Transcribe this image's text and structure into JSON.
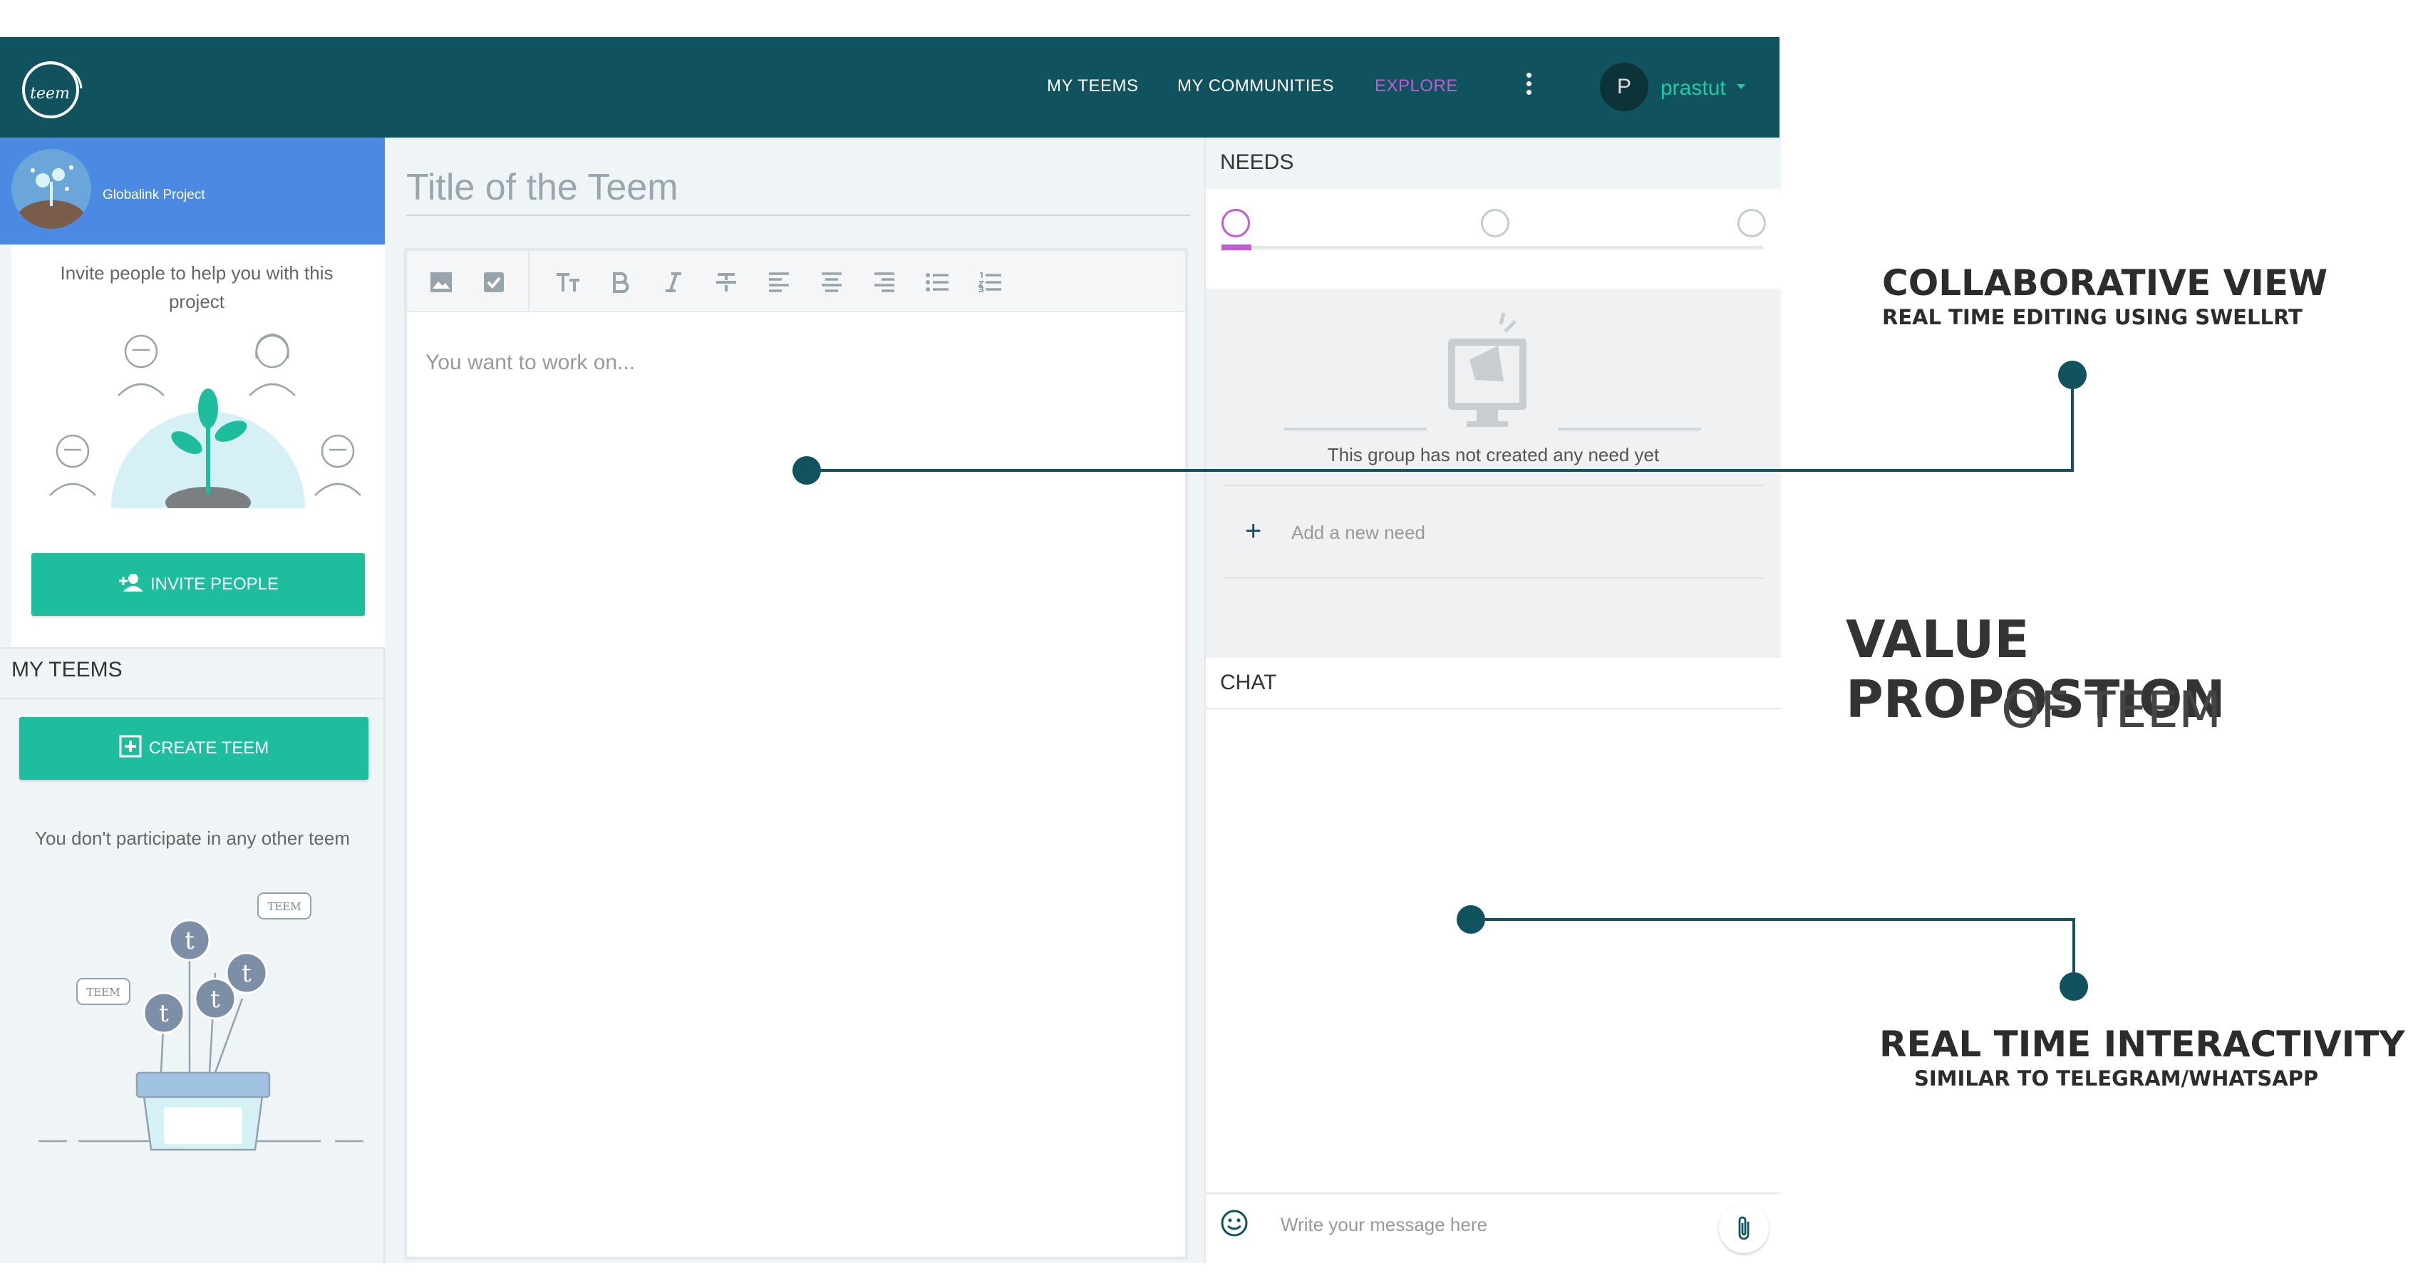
{
  "nav": {
    "my_teems": "MY TEEMS",
    "my_communities": "MY COMMUNITIES",
    "explore": "EXPLORE",
    "avatar_letter": "P",
    "user_name": "prastut",
    "logo_text": "teem",
    "brand_color": "#10535f",
    "explore_color": "#c45bd6"
  },
  "sidebar": {
    "project_name": "Globalink Project",
    "invite_text": "Invite people to help you with this project",
    "invite_button": "INVITE PEOPLE",
    "my_teems_title": "MY TEEMS",
    "create_button": "CREATE TEEM",
    "no_teem_text": "You don't participate in any other teem",
    "bubble_label": "TEEM",
    "button_color": "#1dbd9d",
    "header_color": "#4b89e3"
  },
  "editor": {
    "title_placeholder": "Title of the Teem",
    "body_placeholder": "You want to work on...",
    "toolbar": [
      "image-icon",
      "checkbox-icon",
      "text-size-icon",
      "bold-icon",
      "italic-icon",
      "strikethrough-icon",
      "align-left-icon",
      "align-center-icon",
      "align-right-icon",
      "bullet-list-icon",
      "numbered-list-icon"
    ]
  },
  "needs": {
    "title": "NEEDS",
    "empty_text": "This group has not created any need yet",
    "add_need": "Add a new need"
  },
  "chat": {
    "title": "CHAT",
    "placeholder": "Write your message here"
  },
  "annotations": {
    "collab_title": "COLLABORATIVE VIEW",
    "collab_sub": "REAL TIME EDITING USING SWELLRT",
    "value_title": "VALUE PROPOSTION",
    "value_sub": "OF TEEM",
    "realtime_title": "REAL TIME INTERACTIVITY",
    "realtime_sub": "SIMILAR TO TELEGRAM/WHATSAPP",
    "line_color": "#10535f"
  }
}
